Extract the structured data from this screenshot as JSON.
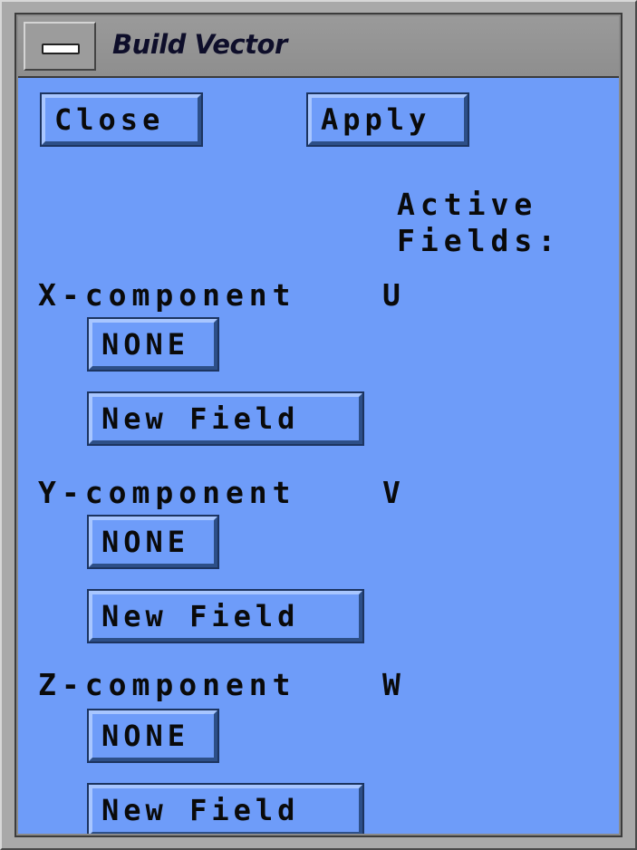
{
  "window": {
    "title": "Build Vector"
  },
  "toolbar": {
    "close_label": "Close",
    "apply_label": "Apply"
  },
  "header": {
    "active_fields_line1": "Active",
    "active_fields_line2": "Fields:"
  },
  "components": [
    {
      "label": "X-component",
      "active_field": "U",
      "none_label": "NONE",
      "new_field_label": "New Field"
    },
    {
      "label": "Y-component",
      "active_field": "V",
      "none_label": "NONE",
      "new_field_label": "New Field"
    },
    {
      "label": "Z-component",
      "active_field": "W",
      "none_label": "NONE",
      "new_field_label": "New Field"
    }
  ],
  "colors": {
    "panel": "#6e9cf9",
    "frame": "#8a8a8a"
  }
}
